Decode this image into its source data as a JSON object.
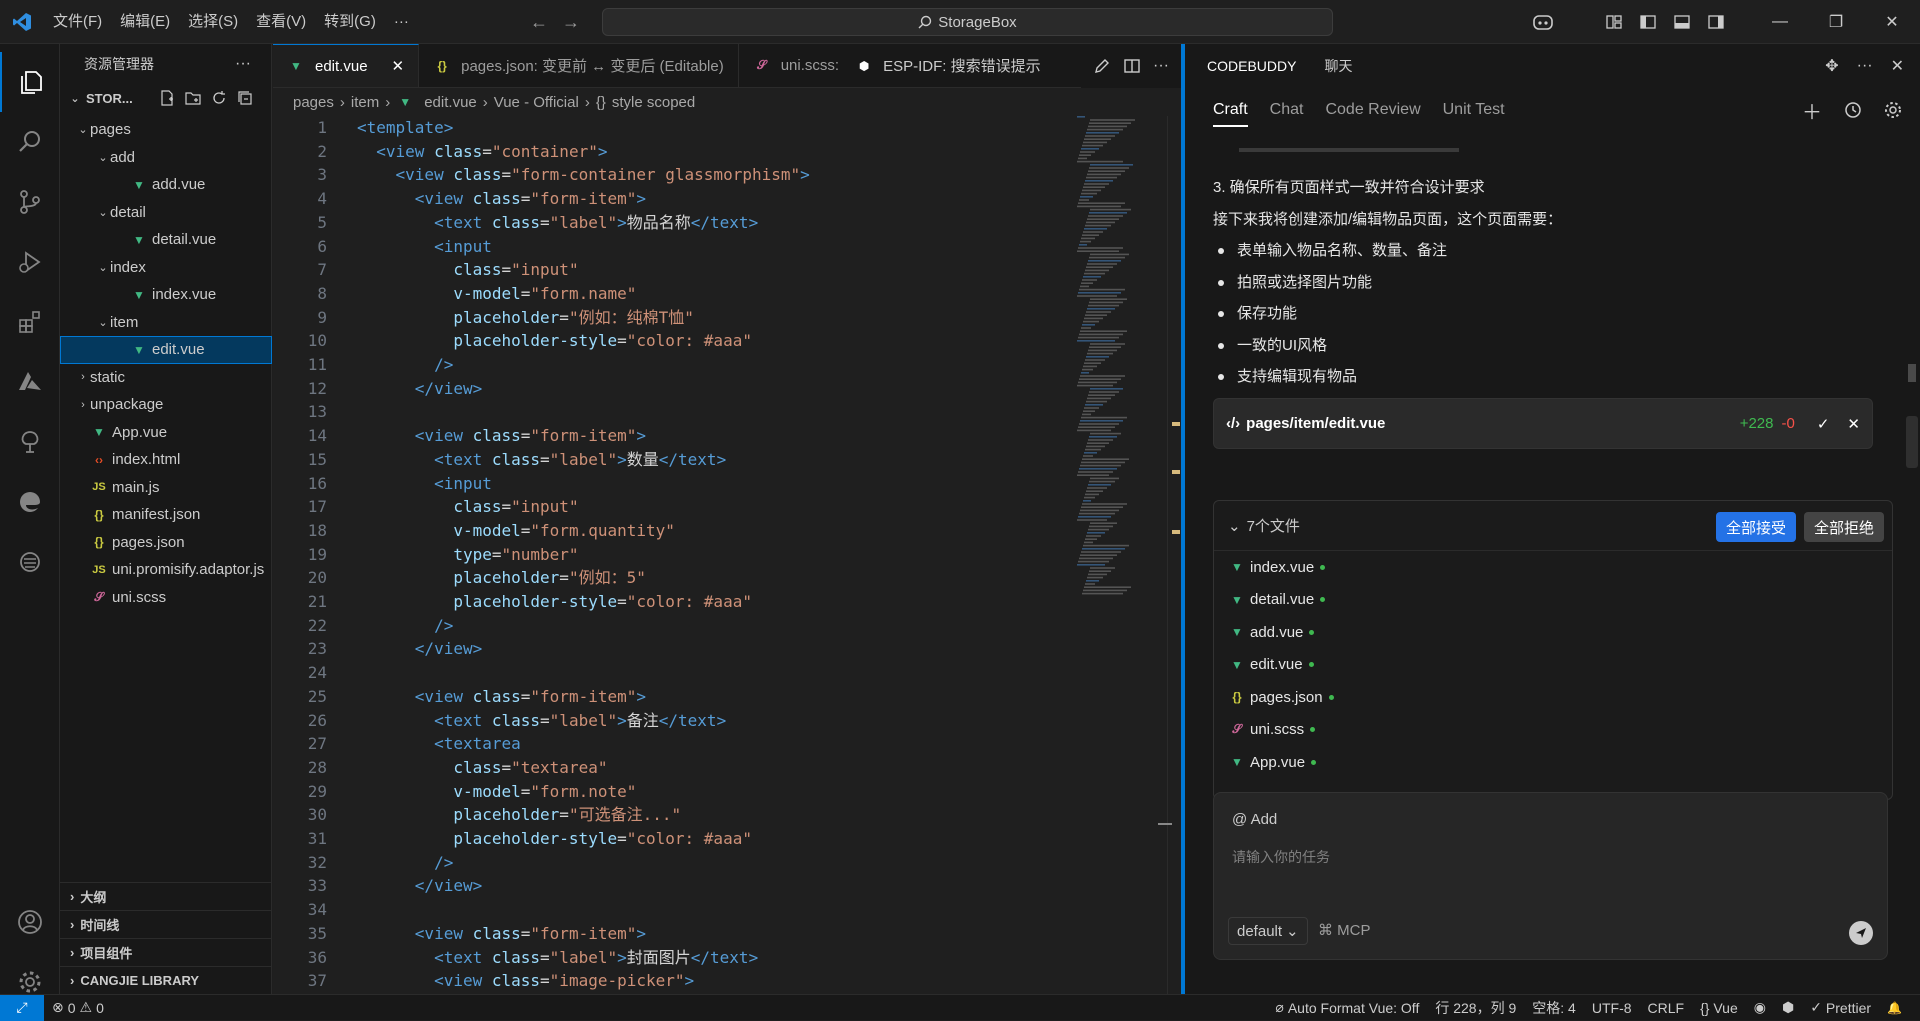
{
  "titlebar": {
    "menu": [
      "文件(F)",
      "编辑(E)",
      "选择(S)",
      "查看(V)",
      "转到(G)",
      "···"
    ],
    "search_text": "StorageBox"
  },
  "sidebar": {
    "title": "资源管理器",
    "root": "STOR...",
    "tree": [
      {
        "label": "pages",
        "depth": 1,
        "type": "folder-open"
      },
      {
        "label": "add",
        "depth": 2,
        "type": "folder-open"
      },
      {
        "label": "add.vue",
        "depth": 3,
        "type": "vue"
      },
      {
        "label": "detail",
        "depth": 2,
        "type": "folder-open"
      },
      {
        "label": "detail.vue",
        "depth": 3,
        "type": "vue"
      },
      {
        "label": "index",
        "depth": 2,
        "type": "folder-open"
      },
      {
        "label": "index.vue",
        "depth": 3,
        "type": "vue"
      },
      {
        "label": "item",
        "depth": 2,
        "type": "folder-open"
      },
      {
        "label": "edit.vue",
        "depth": 3,
        "type": "vue",
        "selected": true
      },
      {
        "label": "static",
        "depth": 1,
        "type": "folder"
      },
      {
        "label": "unpackage",
        "depth": 1,
        "type": "folder"
      },
      {
        "label": "App.vue",
        "depth": 1,
        "type": "vue"
      },
      {
        "label": "index.html",
        "depth": 1,
        "type": "html"
      },
      {
        "label": "main.js",
        "depth": 1,
        "type": "js"
      },
      {
        "label": "manifest.json",
        "depth": 1,
        "type": "json"
      },
      {
        "label": "pages.json",
        "depth": 1,
        "type": "json"
      },
      {
        "label": "uni.promisify.adaptor.js",
        "depth": 1,
        "type": "js"
      },
      {
        "label": "uni.scss",
        "depth": 1,
        "type": "scss"
      }
    ],
    "sections": [
      "大纲",
      "时间线",
      "项目组件",
      "CANGJIE LIBRARY"
    ]
  },
  "editor": {
    "tabs": [
      {
        "label": "edit.vue",
        "icon": "vue",
        "active": true
      },
      {
        "label": "pages.json: 变更前 ↔ 变更后 (Editable)",
        "icon": "json"
      },
      {
        "label": "uni.scss:",
        "icon": "scss"
      },
      {
        "label": "ESP-IDF:  搜索错误提示",
        "icon": "esp"
      }
    ],
    "breadcrumb": [
      "pages",
      "item",
      "edit.vue",
      "Vue - Official",
      "style scoped"
    ],
    "lines": [
      [
        [
          "t",
          "<template>"
        ]
      ],
      [
        [
          "t",
          "  <view "
        ],
        [
          "a",
          "class"
        ],
        [
          "tx",
          "="
        ],
        [
          "s",
          "\"container\""
        ],
        [
          "t",
          ">"
        ]
      ],
      [
        [
          "t",
          "    <view "
        ],
        [
          "a",
          "class"
        ],
        [
          "tx",
          "="
        ],
        [
          "s",
          "\"form-container glassmorphism\""
        ],
        [
          "t",
          ">"
        ]
      ],
      [
        [
          "t",
          "      <view "
        ],
        [
          "a",
          "class"
        ],
        [
          "tx",
          "="
        ],
        [
          "s",
          "\"form-item\""
        ],
        [
          "t",
          ">"
        ]
      ],
      [
        [
          "t",
          "        <text "
        ],
        [
          "a",
          "class"
        ],
        [
          "tx",
          "="
        ],
        [
          "s",
          "\"label\""
        ],
        [
          "t",
          ">"
        ],
        [
          "tx",
          "物品名称"
        ],
        [
          "t",
          "</text>"
        ]
      ],
      [
        [
          "t",
          "        <input"
        ]
      ],
      [
        [
          "a",
          "          class"
        ],
        [
          "tx",
          "="
        ],
        [
          "s",
          "\"input\""
        ]
      ],
      [
        [
          "a",
          "          v-model"
        ],
        [
          "tx",
          "="
        ],
        [
          "s",
          "\"form.name\""
        ]
      ],
      [
        [
          "a",
          "          placeholder"
        ],
        [
          "tx",
          "="
        ],
        [
          "s",
          "\"例如：纯棉T恤\""
        ]
      ],
      [
        [
          "a",
          "          placeholder-style"
        ],
        [
          "tx",
          "="
        ],
        [
          "s",
          "\"color: #aaa\""
        ]
      ],
      [
        [
          "t",
          "        />"
        ]
      ],
      [
        [
          "t",
          "      </view>"
        ]
      ],
      [
        [
          "tx",
          ""
        ]
      ],
      [
        [
          "t",
          "      <view "
        ],
        [
          "a",
          "class"
        ],
        [
          "tx",
          "="
        ],
        [
          "s",
          "\"form-item\""
        ],
        [
          "t",
          ">"
        ]
      ],
      [
        [
          "t",
          "        <text "
        ],
        [
          "a",
          "class"
        ],
        [
          "tx",
          "="
        ],
        [
          "s",
          "\"label\""
        ],
        [
          "t",
          ">"
        ],
        [
          "tx",
          "数量"
        ],
        [
          "t",
          "</text>"
        ]
      ],
      [
        [
          "t",
          "        <input"
        ]
      ],
      [
        [
          "a",
          "          class"
        ],
        [
          "tx",
          "="
        ],
        [
          "s",
          "\"input\""
        ]
      ],
      [
        [
          "a",
          "          v-model"
        ],
        [
          "tx",
          "="
        ],
        [
          "s",
          "\"form.quantity\""
        ]
      ],
      [
        [
          "a",
          "          type"
        ],
        [
          "tx",
          "="
        ],
        [
          "s",
          "\"number\""
        ]
      ],
      [
        [
          "a",
          "          placeholder"
        ],
        [
          "tx",
          "="
        ],
        [
          "s",
          "\"例如：5\""
        ]
      ],
      [
        [
          "a",
          "          placeholder-style"
        ],
        [
          "tx",
          "="
        ],
        [
          "s",
          "\"color: #aaa\""
        ]
      ],
      [
        [
          "t",
          "        />"
        ]
      ],
      [
        [
          "t",
          "      </view>"
        ]
      ],
      [
        [
          "tx",
          ""
        ]
      ],
      [
        [
          "t",
          "      <view "
        ],
        [
          "a",
          "class"
        ],
        [
          "tx",
          "="
        ],
        [
          "s",
          "\"form-item\""
        ],
        [
          "t",
          ">"
        ]
      ],
      [
        [
          "t",
          "        <text "
        ],
        [
          "a",
          "class"
        ],
        [
          "tx",
          "="
        ],
        [
          "s",
          "\"label\""
        ],
        [
          "t",
          ">"
        ],
        [
          "tx",
          "备注"
        ],
        [
          "t",
          "</text>"
        ]
      ],
      [
        [
          "t",
          "        <textarea"
        ]
      ],
      [
        [
          "a",
          "          class"
        ],
        [
          "tx",
          "="
        ],
        [
          "s",
          "\"textarea\""
        ]
      ],
      [
        [
          "a",
          "          v-model"
        ],
        [
          "tx",
          "="
        ],
        [
          "s",
          "\"form.note\""
        ]
      ],
      [
        [
          "a",
          "          placeholder"
        ],
        [
          "tx",
          "="
        ],
        [
          "s",
          "\"可选备注...\""
        ]
      ],
      [
        [
          "a",
          "          placeholder-style"
        ],
        [
          "tx",
          "="
        ],
        [
          "s",
          "\"color: #aaa\""
        ]
      ],
      [
        [
          "t",
          "        />"
        ]
      ],
      [
        [
          "t",
          "      </view>"
        ]
      ],
      [
        [
          "tx",
          ""
        ]
      ],
      [
        [
          "t",
          "      <view "
        ],
        [
          "a",
          "class"
        ],
        [
          "tx",
          "="
        ],
        [
          "s",
          "\"form-item\""
        ],
        [
          "t",
          ">"
        ]
      ],
      [
        [
          "t",
          "        <text "
        ],
        [
          "a",
          "class"
        ],
        [
          "tx",
          "="
        ],
        [
          "s",
          "\"label\""
        ],
        [
          "t",
          ">"
        ],
        [
          "tx",
          "封面图片"
        ],
        [
          "t",
          "</text>"
        ]
      ],
      [
        [
          "t",
          "        <view "
        ],
        [
          "a",
          "class"
        ],
        [
          "tx",
          "="
        ],
        [
          "s",
          "\"image-picker\""
        ],
        [
          "t",
          ">"
        ]
      ]
    ]
  },
  "panel": {
    "header_tabs": [
      "CODEBUDDY",
      "聊天"
    ],
    "tabs": [
      "Craft",
      "Chat",
      "Code Review",
      "Unit Test"
    ],
    "messages": [
      {
        "text": "3. 确保所有页面样式一致并符合设计要求",
        "bullet": false
      },
      {
        "text": "接下来我将创建添加/编辑物品页面，这个页面需要：",
        "bullet": false
      },
      {
        "text": "表单输入物品名称、数量、备注",
        "bullet": true
      },
      {
        "text": "拍照或选择图片功能",
        "bullet": true
      },
      {
        "text": "保存功能",
        "bullet": true
      },
      {
        "text": "一致的UI风格",
        "bullet": true
      },
      {
        "text": "支持编辑现有物品",
        "bullet": true
      }
    ],
    "file_card": {
      "path": "pages/item/edit.vue",
      "added": "+228",
      "removed": "-0"
    },
    "files": {
      "count_label": "7个文件",
      "accept_all": "全部接受",
      "reject_all": "全部拒绝",
      "items": [
        {
          "label": "index.vue",
          "type": "vue"
        },
        {
          "label": "detail.vue",
          "type": "vue"
        },
        {
          "label": "add.vue",
          "type": "vue"
        },
        {
          "label": "edit.vue",
          "type": "vue"
        },
        {
          "label": "pages.json",
          "type": "json"
        },
        {
          "label": "uni.scss",
          "type": "scss"
        },
        {
          "label": "App.vue",
          "type": "vue"
        }
      ]
    },
    "input": {
      "add_label": "@ Add",
      "placeholder": "请输入你的任务",
      "mode": "default",
      "mcp": "MCP"
    }
  },
  "statusbar": {
    "errors": "0",
    "warnings": "0",
    "right": [
      "Auto Format Vue: Off",
      "行 228，列 9",
      "空格: 4",
      "UTF-8",
      "CRLF",
      "{} Vue",
      "Prettier"
    ]
  }
}
